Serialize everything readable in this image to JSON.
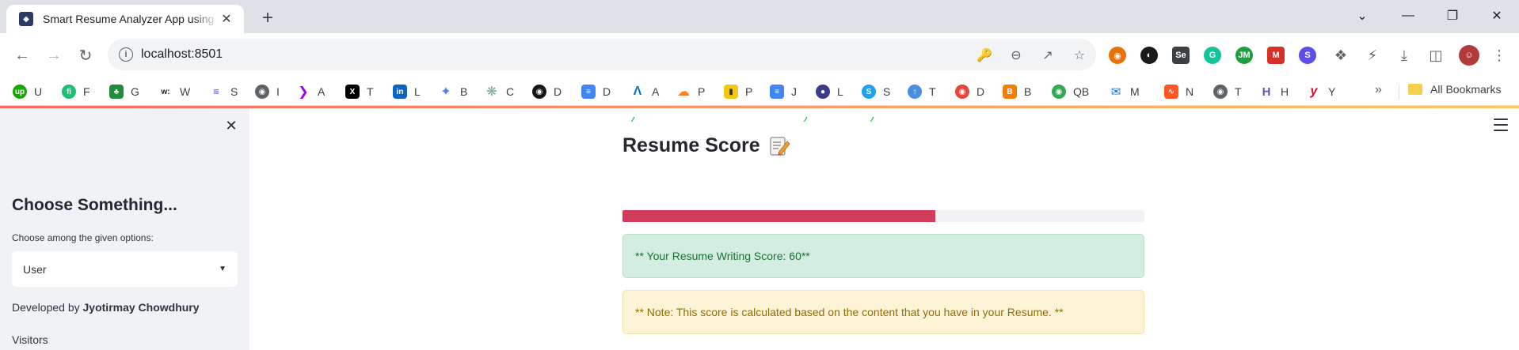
{
  "browser": {
    "tab_title": "Smart Resume Analyzer App using Python",
    "url": "localhost:8501"
  },
  "bookmarks": {
    "items": [
      {
        "label": "U",
        "icon": "upwork-icon",
        "color": "#14a800"
      },
      {
        "label": "F",
        "icon": "fiverr-icon",
        "color": "#1dbf73"
      },
      {
        "label": "G",
        "icon": "green-leaf-icon",
        "color": "#1e8e3e"
      },
      {
        "label": "W",
        "icon": "w-text-icon",
        "color": "#202124"
      },
      {
        "label": "S",
        "icon": "stripes-icon",
        "color": "#6366f1"
      },
      {
        "label": "I",
        "icon": "globe-icon",
        "color": "#5f6368"
      },
      {
        "label": "A",
        "icon": "accenture-icon",
        "color": "#a100ff"
      },
      {
        "label": "T",
        "icon": "x-twitter-icon",
        "color": "#000000"
      },
      {
        "label": "L",
        "icon": "linkedin-icon",
        "color": "#0a66c2"
      },
      {
        "label": "B",
        "icon": "sparkle-icon",
        "color": "#4f7ef2"
      },
      {
        "label": "C",
        "icon": "openai-icon",
        "color": "#74aa9c"
      },
      {
        "label": "D",
        "icon": "github-icon",
        "color": "#181717"
      },
      {
        "label": "D",
        "icon": "docs-icon",
        "color": "#4285f4"
      },
      {
        "label": "A",
        "icon": "azure-icon",
        "color": "#0078d4"
      },
      {
        "label": "P",
        "icon": "cloudflare-icon",
        "color": "#f38020"
      },
      {
        "label": "P",
        "icon": "powerbi-icon",
        "color": "#f2c811"
      },
      {
        "label": "J",
        "icon": "docs-icon",
        "color": "#4285f4"
      },
      {
        "label": "L",
        "icon": "logo-circle-icon",
        "color": "#3c3c8c"
      },
      {
        "label": "S",
        "icon": "s-circle-icon",
        "color": "#1da1f2"
      },
      {
        "label": "T",
        "icon": "upload-circle-icon",
        "color": "#4a90e2"
      },
      {
        "label": "D",
        "icon": "chrome-ext-icon",
        "color": "#e8453c"
      },
      {
        "label": "B",
        "icon": "blogger-icon",
        "color": "#f57d00"
      },
      {
        "label": "QB",
        "icon": "robot-icon",
        "color": "#34a853"
      },
      {
        "label": "M",
        "icon": "mail-icon",
        "color": "#1a73e8"
      },
      {
        "label": "N",
        "icon": "wave-icon",
        "color": "#ff5722"
      },
      {
        "label": "T",
        "icon": "globe-icon",
        "color": "#5f6368"
      },
      {
        "label": "H",
        "icon": "h-logo-icon",
        "color": "#6b4fbb"
      },
      {
        "label": "Y",
        "icon": "y-logo-icon",
        "color": "#e60023"
      }
    ],
    "all_bookmarks": "All Bookmarks"
  },
  "sidebar": {
    "heading": "Choose Something...",
    "caption": "Choose among the given options:",
    "select_value": "User",
    "developed_prefix": "Developed by ",
    "developer": "Jyotirmay Chowdhury",
    "visitors": "Visitors"
  },
  "main": {
    "section_title": "Resume Score",
    "section_icon": "memo-icon",
    "progress_fraction": 0.6,
    "progress_color": "#d33b5c",
    "success_text": "** Your Resume Writing Score: 60**",
    "warning_text": "** Note: This score is calculated based on the content that you have in your Resume. **"
  }
}
